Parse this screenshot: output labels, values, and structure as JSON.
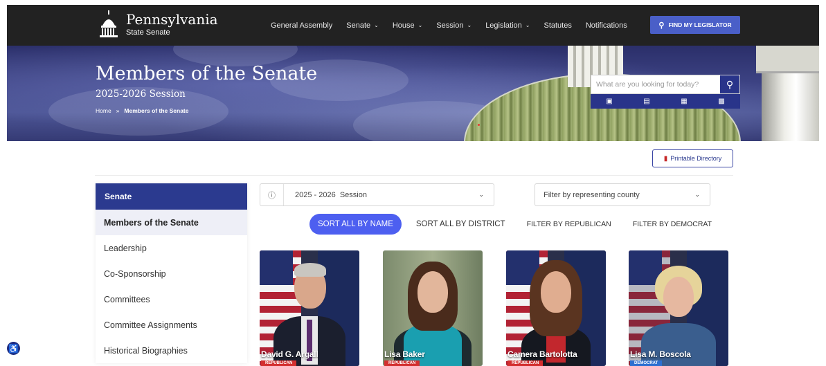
{
  "header": {
    "brand_title": "Pennsylvania",
    "brand_sub": "State Senate",
    "nav": [
      {
        "label": "General Assembly",
        "dropdown": false
      },
      {
        "label": "Senate",
        "dropdown": true
      },
      {
        "label": "House",
        "dropdown": true
      },
      {
        "label": "Session",
        "dropdown": true
      },
      {
        "label": "Legislation",
        "dropdown": true
      },
      {
        "label": "Statutes",
        "dropdown": false
      },
      {
        "label": "Notifications",
        "dropdown": false
      }
    ],
    "find_legislator": "FIND MY LEGISLATOR"
  },
  "hero": {
    "title": "Members of the Senate",
    "subtitle": "2025-2026 Session",
    "breadcrumb_home": "Home",
    "breadcrumb_sep": "»",
    "breadcrumb_current": "Members of the Senate",
    "search_placeholder": "What are you looking for today?"
  },
  "toolbar": {
    "printable_directory": "Printable Directory"
  },
  "sidebar": {
    "heading": "Senate",
    "items": [
      {
        "label": "Members of the Senate",
        "active": true
      },
      {
        "label": "Leadership",
        "active": false
      },
      {
        "label": "Co-Sponsorship",
        "active": false
      },
      {
        "label": "Committees",
        "active": false
      },
      {
        "label": "Committee Assignments",
        "active": false
      },
      {
        "label": "Historical Biographies",
        "active": false
      }
    ]
  },
  "filters": {
    "session_value": "2025 - 2026  Session",
    "county_placeholder": "Filter by representing county",
    "sort_by_name": "SORT ALL BY NAME",
    "sort_by_district": "SORT ALL BY DISTRICT",
    "filter_republican": "FILTER BY REPUBLICAN",
    "filter_democrat": "FILTER BY DEMOCRAT"
  },
  "members": [
    {
      "name": "David G. Argall",
      "party": "REPUBLICAN"
    },
    {
      "name": "Lisa Baker",
      "party": "REPUBLICAN"
    },
    {
      "name": "Camera Bartolotta",
      "party": "REPUBLICAN"
    },
    {
      "name": "Lisa M. Boscola",
      "party": "DEMOCRAT"
    }
  ],
  "colors": {
    "nav_bg": "#222222",
    "primary_blue": "#2b3a8f",
    "accent_button": "#4d5ff0",
    "republican": "#d32f2f",
    "democrat": "#2c6fd1"
  }
}
